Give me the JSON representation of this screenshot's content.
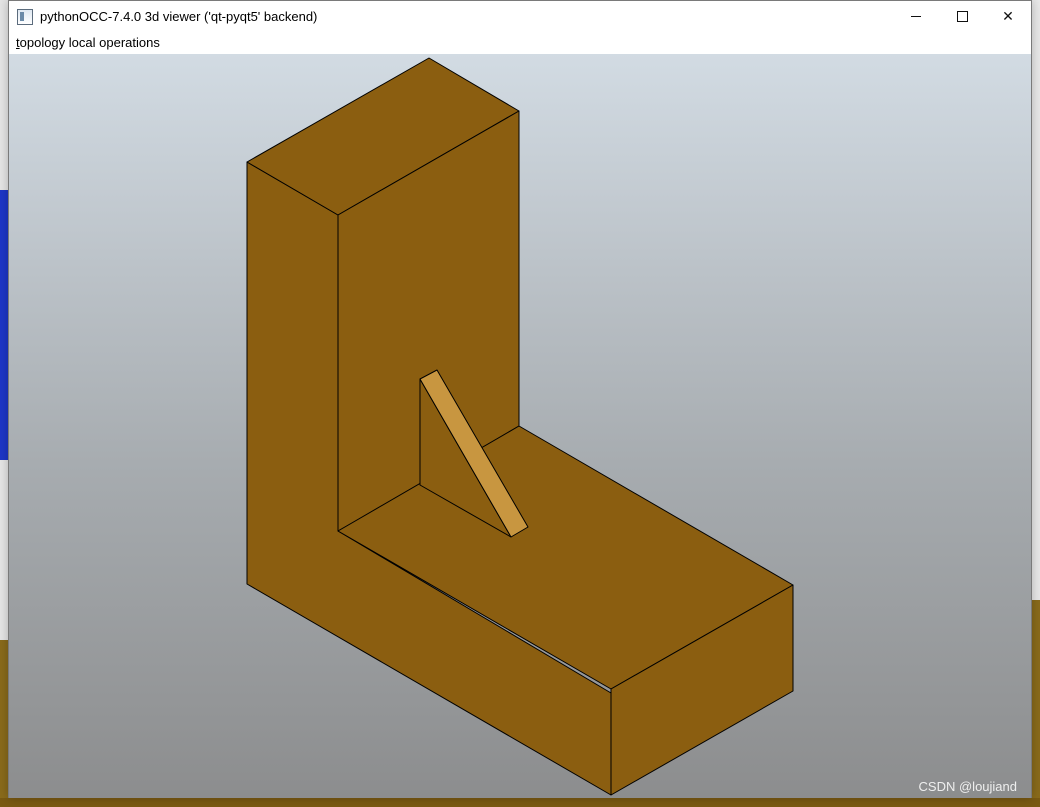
{
  "window": {
    "title": "pythonOCC-7.4.0 3d viewer ('qt-pyqt5' backend)",
    "controls": {
      "minimize": "minimize",
      "maximize": "maximize",
      "close": "✕"
    }
  },
  "menubar": {
    "items": [
      {
        "label_first": "t",
        "label_rest": "opology local operations"
      }
    ]
  },
  "viewport": {
    "background_top": "#d2dbe3",
    "background_bottom": "#8c8d8e",
    "solid_color": "#8b5e10",
    "rib_color": "#c89640",
    "edge_color": "#000000"
  },
  "watermark": "CSDN @loujiand"
}
